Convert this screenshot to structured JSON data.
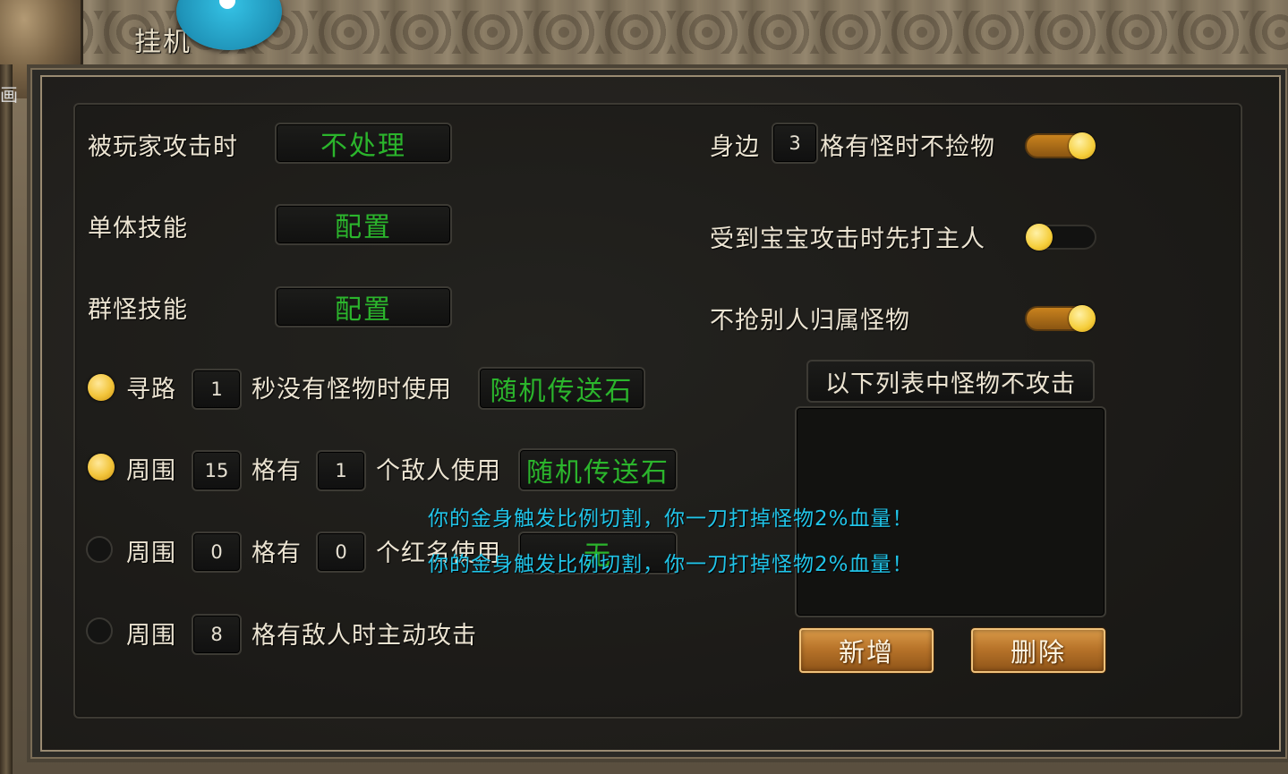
{
  "window": {
    "title": "挂机"
  },
  "side_mark": "画",
  "left_options": {
    "attacked_by_player": {
      "label": "被玩家攻击时",
      "value": "不处理"
    },
    "single_skill": {
      "label": "单体技能",
      "value": "配置"
    },
    "group_skill": {
      "label": "群怪技能",
      "value": "配置"
    }
  },
  "rules": [
    {
      "enabled": true,
      "prefix": "寻路",
      "num1": "1",
      "mid": "秒没有怪物时使用",
      "item": "随机传送石"
    },
    {
      "enabled": true,
      "prefix": "周围",
      "num1": "15",
      "mid": "格有",
      "num2": "1",
      "suffix": "个敌人使用",
      "item": "随机传送石"
    },
    {
      "enabled": false,
      "prefix": "周围",
      "num1": "0",
      "mid": "格有",
      "num2": "0",
      "suffix": "个红名使用",
      "item": "无"
    },
    {
      "enabled": false,
      "prefix": "周围",
      "num1": "8",
      "mid": "格有敌人时主动攻击"
    }
  ],
  "right_options": {
    "no_pickup": {
      "prefix": "身边",
      "num": "3",
      "label": "格有怪时不捡物",
      "on": true
    },
    "attack_master": {
      "label": "受到宝宝攻击时先打主人",
      "on": false
    },
    "no_steal": {
      "label": "不抢别人归属怪物",
      "on": true
    }
  },
  "monster_list": {
    "header": "以下列表中怪物不攻击",
    "items": []
  },
  "buttons": {
    "add": "新增",
    "delete": "删除"
  },
  "messages": [
    "你的金身触发比例切割，你一刀打掉怪物2%血量！",
    "你的金身触发比例切割，你一刀打掉怪物2%血量！"
  ],
  "colors": {
    "value_green": "#2bb52c",
    "message_cyan": "#21c4e8",
    "gold": "#f2c43a"
  }
}
